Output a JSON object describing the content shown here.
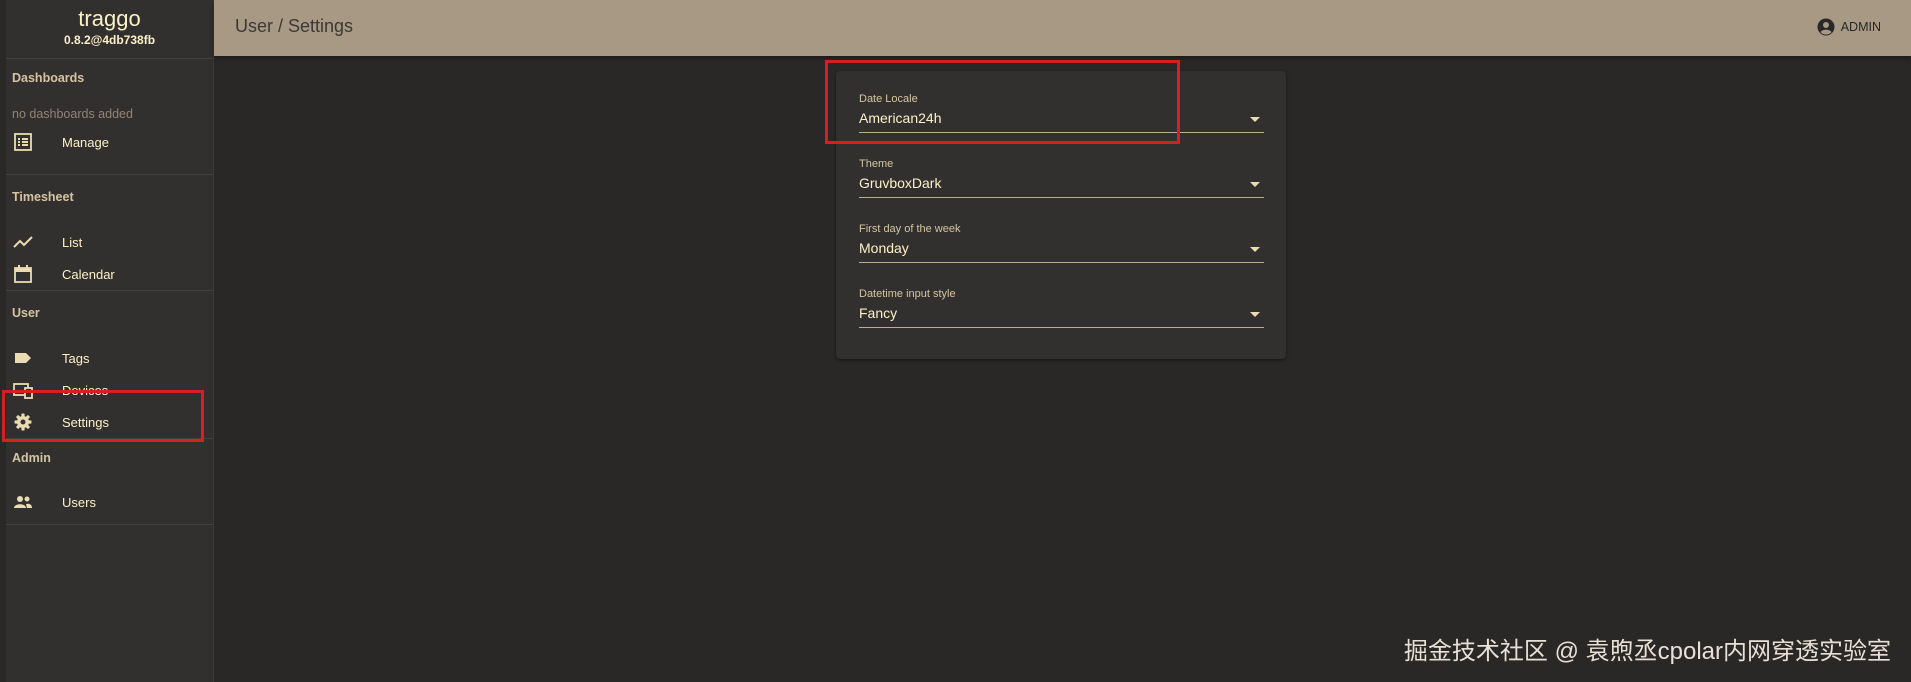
{
  "app": {
    "name": "traggo",
    "version": "0.8.2@4db738fb"
  },
  "sidebar": {
    "dashboards": {
      "title": "Dashboards",
      "empty_text": "no dashboards added",
      "items": [
        {
          "label": "Manage",
          "icon": "list-icon"
        }
      ]
    },
    "timesheet": {
      "title": "Timesheet",
      "items": [
        {
          "label": "List",
          "icon": "chart-line-icon"
        },
        {
          "label": "Calendar",
          "icon": "calendar-icon"
        }
      ]
    },
    "user": {
      "title": "User",
      "items": [
        {
          "label": "Tags",
          "icon": "tag-icon"
        },
        {
          "label": "Devices",
          "icon": "devices-icon"
        },
        {
          "label": "Settings",
          "icon": "gear-icon"
        }
      ]
    },
    "admin": {
      "title": "Admin",
      "items": [
        {
          "label": "Users",
          "icon": "users-icon"
        }
      ]
    }
  },
  "header": {
    "title": "User / Settings",
    "user_label": "ADMIN"
  },
  "settings": {
    "fields": [
      {
        "label": "Date Locale",
        "value": "American24h"
      },
      {
        "label": "Theme",
        "value": "GruvboxDark"
      },
      {
        "label": "First day of the week",
        "value": "Monday"
      },
      {
        "label": "Datetime input style",
        "value": "Fancy"
      }
    ]
  },
  "watermark": "掘金技术社区 @ 袁煦丞cpolar内网穿透实验室",
  "colors": {
    "topbar": "#a89984",
    "sidebar": "#32302f",
    "background": "#2a2827",
    "highlight": "#d42020"
  }
}
